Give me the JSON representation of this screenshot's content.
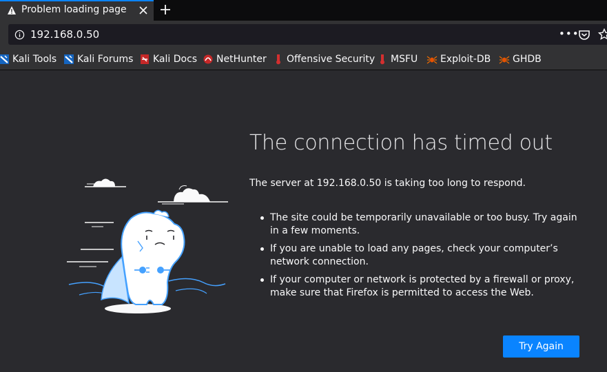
{
  "tab": {
    "title": "Problem loading page"
  },
  "urlbar": {
    "url": "192.168.0.50",
    "more": "•••"
  },
  "bookmarks": [
    {
      "label": "Kali Tools",
      "icon": "kali-icon"
    },
    {
      "label": "Kali Forums",
      "icon": "kali-icon"
    },
    {
      "label": "Kali Docs",
      "icon": "kali-docs-icon"
    },
    {
      "label": "NetHunter",
      "icon": "nethunter-icon"
    },
    {
      "label": "Offensive Security",
      "icon": "offsec-icon"
    },
    {
      "label": "MSFU",
      "icon": "offsec-icon"
    },
    {
      "label": "Exploit-DB",
      "icon": "spider-icon"
    },
    {
      "label": "GHDB",
      "icon": "spider-icon"
    }
  ],
  "error": {
    "title": "The connection has timed out",
    "description": "The server at 192.168.0.50 is taking too long to respond.",
    "bullets": [
      "The site could be temporarily unavailable or too busy. Try again in a few moments.",
      "If you are unable to load any pages, check your computer’s network connection.",
      "If your computer or network is protected by a firewall or proxy, make sure that Firefox is permitted to access the Web."
    ],
    "button": "Try Again"
  },
  "colors": {
    "accent": "#0a84ff",
    "background": "#2a2a2e",
    "toolbar": "#323234"
  }
}
